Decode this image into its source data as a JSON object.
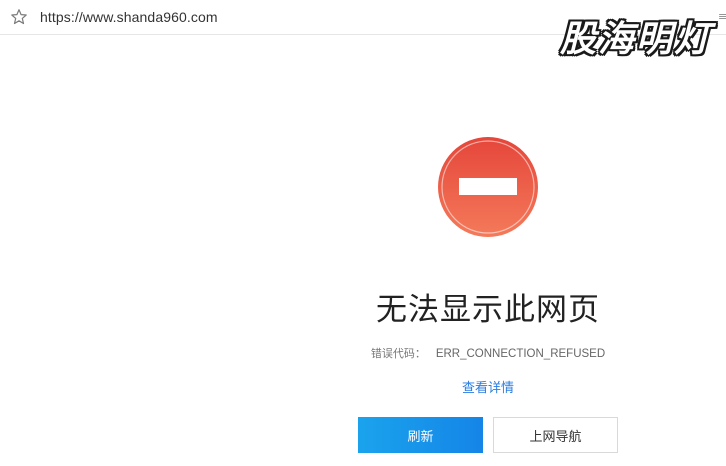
{
  "address_bar": {
    "url": "https://www.shanda960.com"
  },
  "watermark": {
    "text": "股海明灯"
  },
  "error": {
    "title": "无法显示此网页",
    "code_label": "错误代码：",
    "code_value": "ERR_CONNECTION_REFUSED",
    "details_link": "查看详情"
  },
  "buttons": {
    "refresh_label": "刷新",
    "nav_label": "上网导航"
  },
  "icons": {
    "bookmark": "star-icon",
    "error": "no-entry-icon"
  },
  "colors": {
    "error_icon_top": "#e5463a",
    "error_icon_bottom": "#f47a5a",
    "link": "#2a7de1",
    "refresh_button": "#1592e8"
  }
}
